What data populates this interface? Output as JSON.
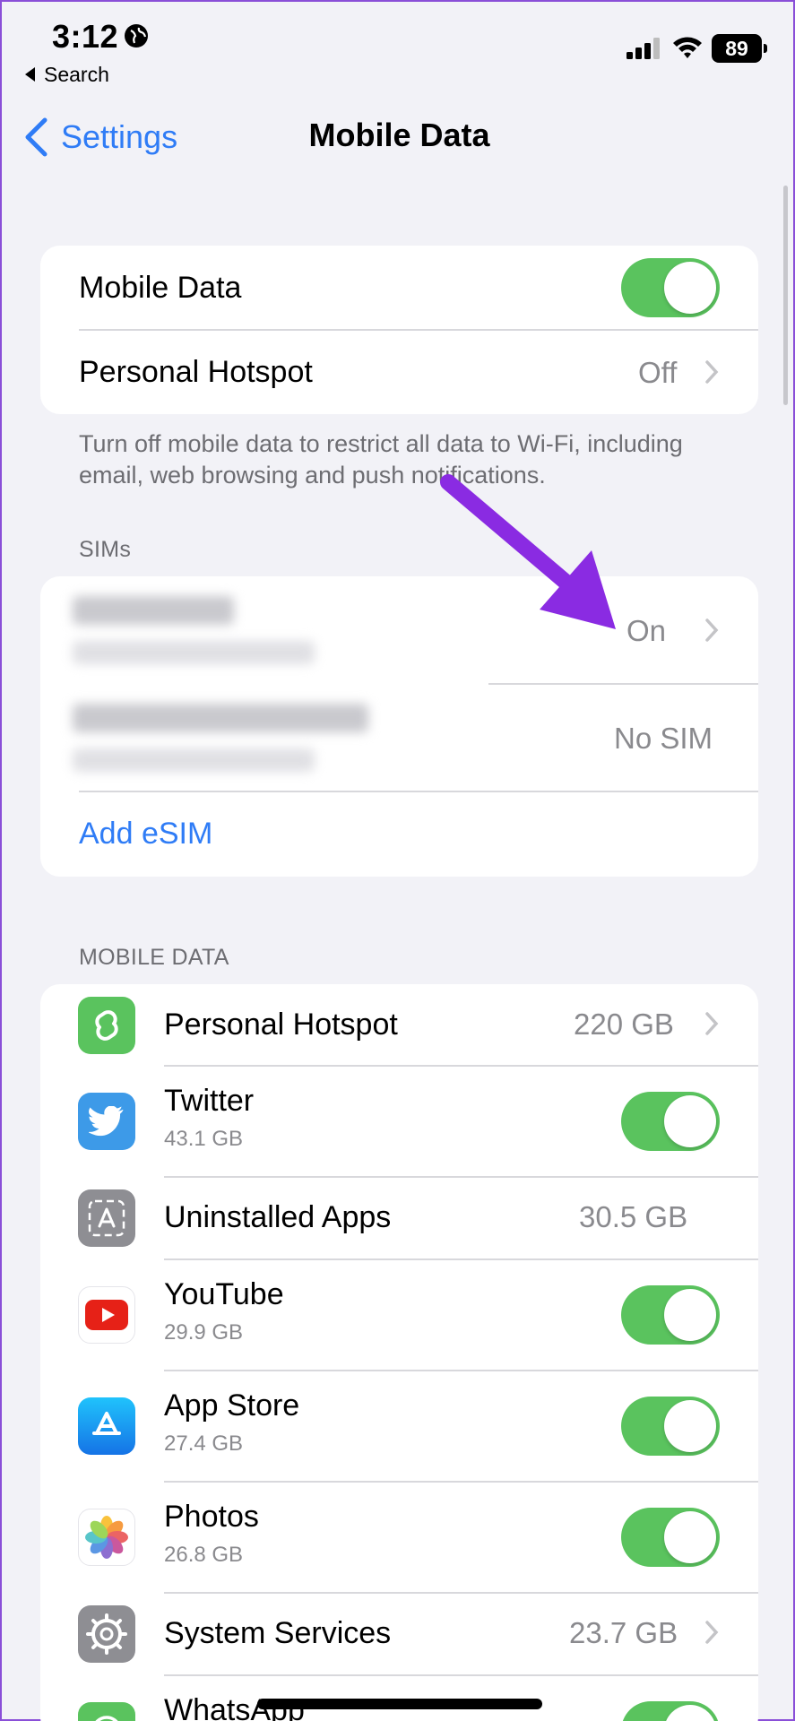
{
  "status": {
    "time": "3:12",
    "back_app": "Search",
    "battery": "89"
  },
  "nav": {
    "back_label": "Settings",
    "title": "Mobile Data"
  },
  "main_group": {
    "mobile_data_label": "Mobile Data",
    "mobile_data_on": true,
    "hotspot_label": "Personal Hotspot",
    "hotspot_value": "Off"
  },
  "footnote": "Turn off mobile data to restrict all data to Wi-Fi, including email, web browsing and push notifications.",
  "sims": {
    "header": "SIMs",
    "sim1_status": "On",
    "sim2_status": "No SIM",
    "add_esim": "Add eSIM"
  },
  "usage": {
    "header": "MOBILE DATA",
    "apps": [
      {
        "name": "Personal Hotspot",
        "value": "220 GB",
        "icon": "hotspot-icon",
        "color": "#5ac35e"
      },
      {
        "name": "Twitter",
        "size": "43.1 GB",
        "toggle": true,
        "icon": "twitter-icon",
        "color": "#3d9ae8"
      },
      {
        "name": "Uninstalled Apps",
        "value": "30.5 GB",
        "icon": "uninstalled-apps-icon",
        "color": "#8e8e93"
      },
      {
        "name": "YouTube",
        "size": "29.9 GB",
        "toggle": true,
        "icon": "youtube-icon",
        "color": "#e62117"
      },
      {
        "name": "App Store",
        "size": "27.4 GB",
        "toggle": true,
        "icon": "app-store-icon",
        "color": "#1e8cf6"
      },
      {
        "name": "Photos",
        "size": "26.8 GB",
        "toggle": true,
        "icon": "photos-icon",
        "color": "#ffffff"
      },
      {
        "name": "System Services",
        "value": "23.7 GB",
        "icon": "gear-icon",
        "color": "#8e8e93"
      },
      {
        "name": "WhatsApp",
        "toggle": true,
        "icon": "whatsapp-icon",
        "color": "#5ac35e"
      }
    ]
  },
  "colors": {
    "accent": "#2f7cf6",
    "toggle_on": "#5ac35e",
    "annotation_arrow": "#8a2be2"
  }
}
